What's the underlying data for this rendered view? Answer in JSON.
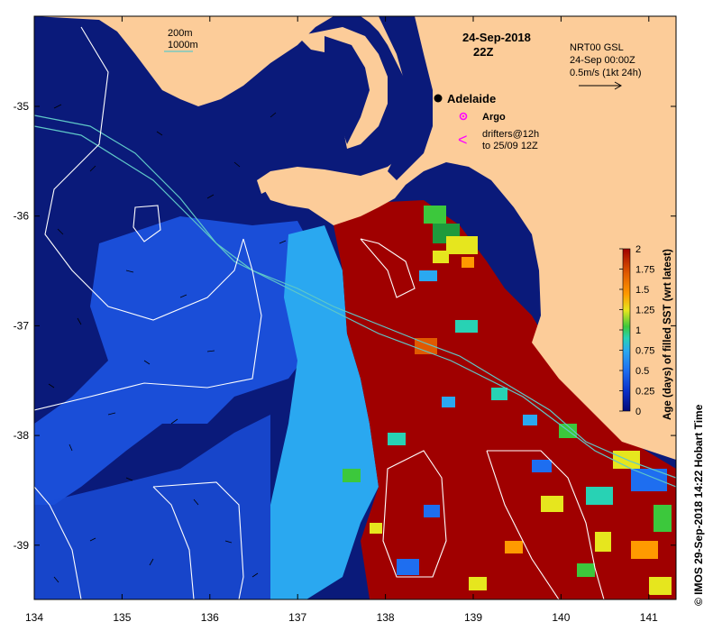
{
  "header": {
    "date": "24-Sep-2018",
    "time": "22Z"
  },
  "bathymetry_legend": {
    "contour_a": "200m",
    "contour_b": "1000m",
    "line_color": "#5fc8c8"
  },
  "current_legend": {
    "line1": "NRT00 GSL",
    "line2": "24-Sep 00:00Z",
    "line3": "0.5m/s (1kt 24h)"
  },
  "map_labels": {
    "city": "Adelaide",
    "argo": "Argo",
    "drifters_line1": "drifters@12h",
    "drifters_line2": "to 25/09 12Z",
    "drifter_symbol": "<"
  },
  "axes": {
    "x_ticks": [
      "134",
      "135",
      "136",
      "137",
      "138",
      "139",
      "140",
      "141"
    ],
    "y_ticks": [
      "-35",
      "-36",
      "-37",
      "-38",
      "-39"
    ]
  },
  "colorbar": {
    "title": "Age (days) of filled SST (wrt latest)",
    "ticks": [
      "2",
      "1.75",
      "1.5",
      "1.25",
      "1",
      "0.75",
      "0.5",
      "0.25",
      "0"
    ],
    "colors": [
      "#050a78",
      "#0a2fc8",
      "#1e6ef0",
      "#2aa8f0",
      "#28d2b4",
      "#3cc83c",
      "#e6e61e",
      "#ff9a00",
      "#e05a00",
      "#a00000"
    ]
  },
  "footer": {
    "credit": "© IMOS 29-Sep-2018 14:22 Hobart Time"
  },
  "colors": {
    "land": "#fccc99",
    "deep_ocean": "#0a1a7a",
    "ocean_mid": "#1a4ed8",
    "ocean_light": "#2aa8f0",
    "warm_age": "#a00000",
    "argo": "#ff00ff"
  }
}
